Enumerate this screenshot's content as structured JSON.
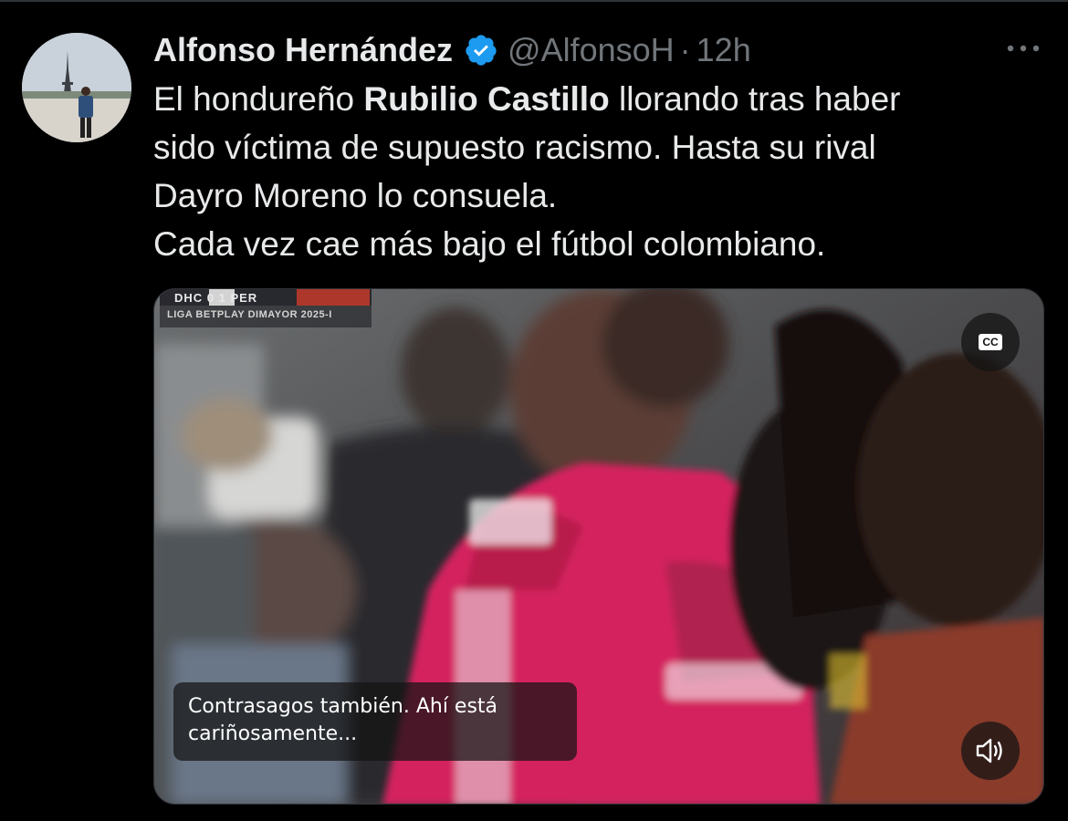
{
  "tweet": {
    "author_name": "Alfonso Hernández",
    "handle": "@AlfonsoH",
    "separator": "·",
    "time": "12h",
    "verified": true,
    "text_lines": [
      {
        "before": "El hondureño ",
        "bold": "Rubilio Castillo",
        "after": " llorando tras haber"
      },
      {
        "text": "sido víctima de supuesto racismo. Hasta su rival"
      },
      {
        "text": "Dayro Moreno lo consuela."
      },
      {
        "text": "Cada vez cae más bajo el fútbol colombiano."
      }
    ]
  },
  "video": {
    "scorebug": {
      "teams": "DHC 0 1 PER",
      "league": "LIGA BETPLAY DIMAYOR 2025-I"
    },
    "cc_label": "CC",
    "caption_lines": [
      "Contrasagos también. Ahí está",
      "cariñosamente..."
    ]
  },
  "icons": {
    "more": "more-horizontal-icon",
    "verified": "verified-badge-icon",
    "cc": "closed-captions-icon",
    "volume": "volume-icon"
  },
  "colors": {
    "background": "#000000",
    "text_primary": "#e7e9ea",
    "text_secondary": "#71767b",
    "verified_blue": "#1d9bf0",
    "jersey_pink": "#d4245e"
  }
}
